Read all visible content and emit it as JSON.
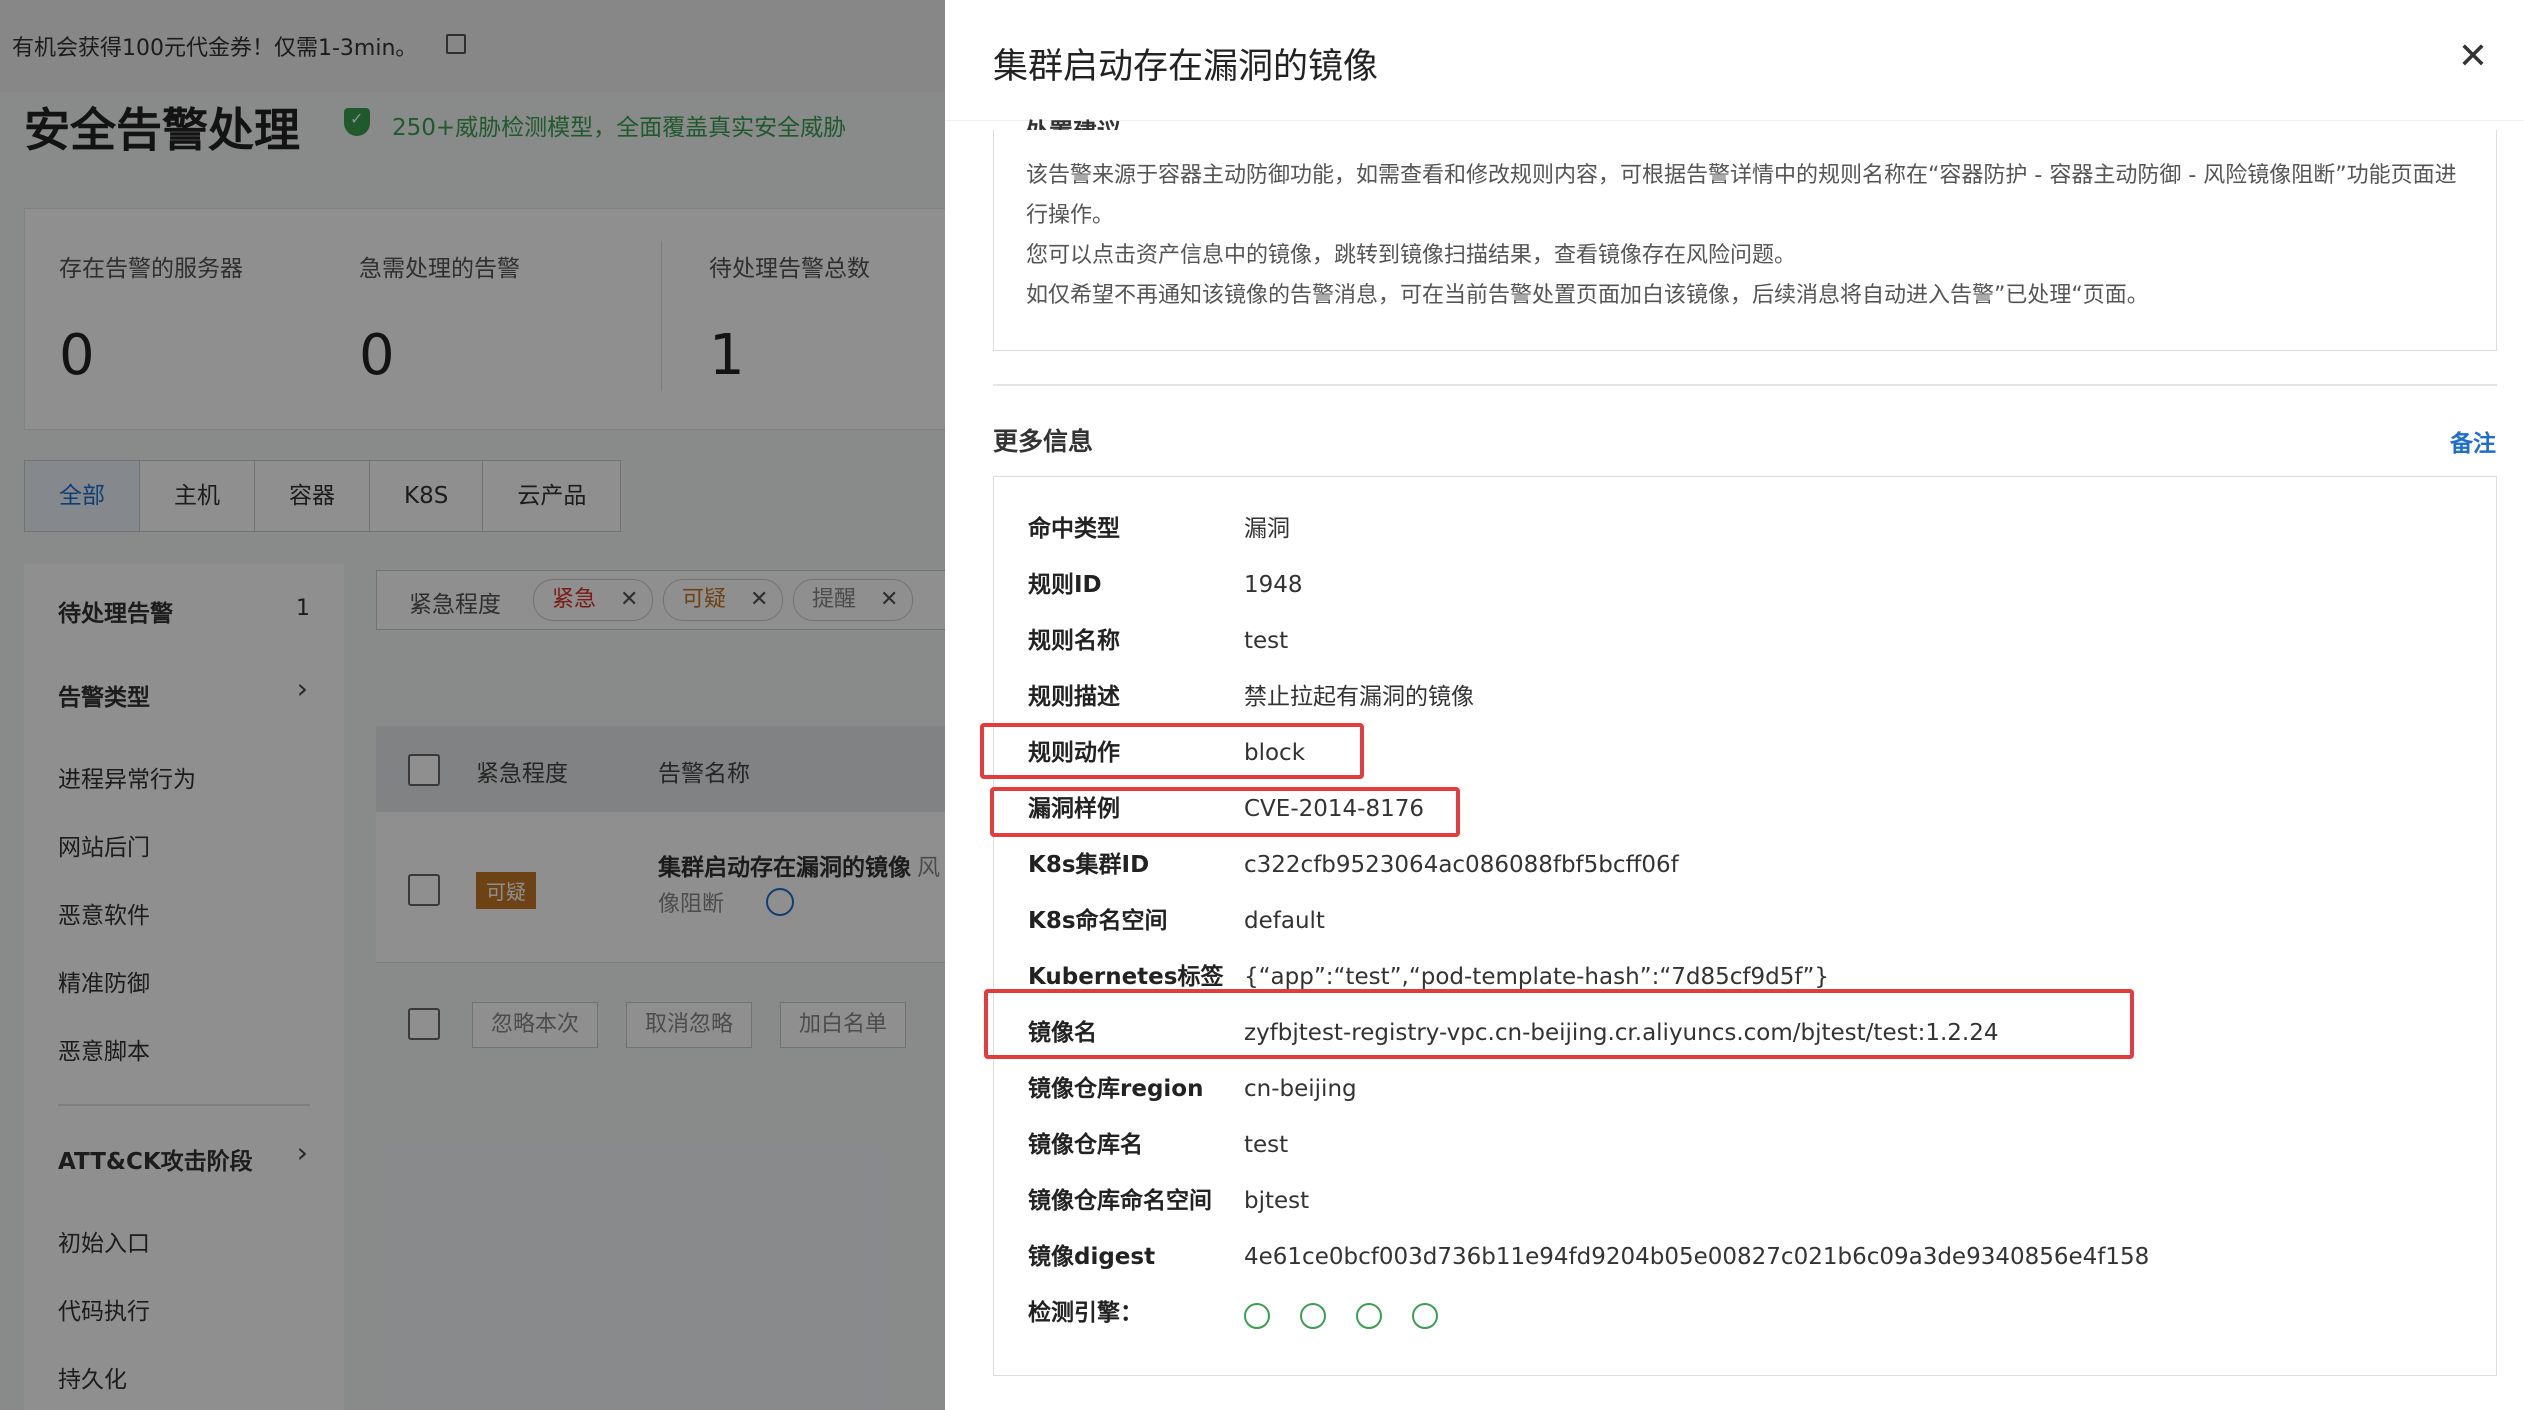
{
  "background": {
    "promo_text": "有机会获得100元代金券！仅需1-3min。",
    "page_title": "安全告警处理",
    "slogan": "250+威胁检测模型，全面覆盖真实安全威胁",
    "stats": [
      {
        "label": "存在告警的服务器",
        "value": "0"
      },
      {
        "label": "急需处理的告警",
        "value": "0"
      },
      {
        "label": "待处理告警总数",
        "value": "1"
      }
    ],
    "tabs": [
      "全部",
      "主机",
      "容器",
      "K8S",
      "云产品"
    ],
    "nav": {
      "pending_label": "待处理告警",
      "pending_count": "1",
      "alert_type": "告警类型",
      "items": [
        "进程异常行为",
        "网站后门",
        "恶意软件",
        "精准防御",
        "恶意脚本"
      ],
      "attck": "ATT&CK攻击阶段",
      "stages": [
        "初始入口",
        "代码执行",
        "持久化"
      ]
    },
    "filter": {
      "label": "紧急程度",
      "tags": [
        {
          "text": "紧急",
          "color": "#d93026"
        },
        {
          "text": "可疑",
          "color": "#c27724"
        },
        {
          "text": "提醒",
          "color": "#888888"
        }
      ]
    },
    "table": {
      "col_severity": "紧急程度",
      "col_name": "告警名称",
      "row_badge": "可疑",
      "row_name": "集群启动存在漏洞的镜像",
      "row_name_tail": "风",
      "row_sub": "像阻断"
    },
    "bulk_buttons": [
      "忽略本次",
      "取消忽略",
      "加白名单"
    ]
  },
  "drawer": {
    "title": "集群启动存在漏洞的镜像",
    "advice_heading": "处置建议",
    "advice_lines": [
      "该告警来源于容器主动防御功能，如需查看和修改规则内容，可根据告警详情中的规则名称在“容器防护 - 容器主动防御 - 风险镜像阻断”功能页面进行操作。",
      "您可以点击资产信息中的镜像，跳转到镜像扫描结果，查看镜像存在风险问题。",
      "如仅希望不再通知该镜像的告警消息，可在当前告警处置页面加白该镜像，后续消息将自动进入告警”已处理“页面。"
    ],
    "more_title": "更多信息",
    "note_link": "备注",
    "info": [
      {
        "k": "命中类型",
        "v": "漏洞"
      },
      {
        "k": "规则ID",
        "v": "1948"
      },
      {
        "k": "规则名称",
        "v": "test"
      },
      {
        "k": "规则描述",
        "v": "禁止拉起有漏洞的镜像"
      },
      {
        "k": "规则动作",
        "v": "block"
      },
      {
        "k": "漏洞样例",
        "v": "CVE-2014-8176"
      },
      {
        "k": "K8s集群ID",
        "v": "c322cfb9523064ac086088fbf5bcff06f"
      },
      {
        "k": "K8s命名空间",
        "v": "default"
      },
      {
        "k": "Kubernetes标签",
        "v": "{“app”:“test”,“pod-template-hash”:“7d85cf9d5f”}"
      },
      {
        "k": "镜像名",
        "v": "zyfbjtest-registry-vpc.cn-beijing.cr.aliyuncs.com/bjtest/test:1.2.24"
      },
      {
        "k": "镜像仓库region",
        "v": "cn-beijing"
      },
      {
        "k": "镜像仓库名",
        "v": "test"
      },
      {
        "k": "镜像仓库命名空间",
        "v": "bjtest"
      },
      {
        "k": "镜像digest",
        "v": "4e61ce0bcf003d736b11e94fd9204b05e00827c021b6c09a3de9340856e4f158"
      },
      {
        "k": "检测引擎：",
        "v": ""
      }
    ],
    "engine_icons": [
      "engine-1-icon",
      "engine-2-icon",
      "engine-3-icon",
      "engine-4-icon"
    ],
    "highlight_color": "#e23c3c"
  }
}
